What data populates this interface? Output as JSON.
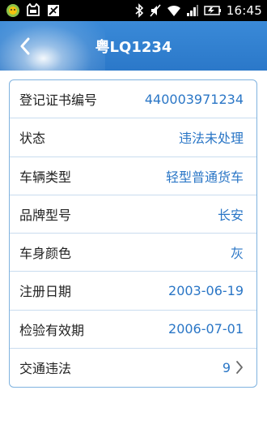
{
  "status_bar": {
    "time": "16:45",
    "left_icons": [
      "wechat-icon",
      "cat-icon",
      "nosim-icon"
    ],
    "right_icons": [
      "bluetooth-icon",
      "mute-icon",
      "wifi-icon",
      "signal-icon",
      "battery-icon"
    ]
  },
  "header": {
    "title": "粤LQ1234",
    "back_icon": "chevron-left-icon"
  },
  "details": [
    {
      "label": "登记证书编号",
      "value": "440003971234"
    },
    {
      "label": "状态",
      "value": "违法未处理"
    },
    {
      "label": "车辆类型",
      "value": "轻型普通货车"
    },
    {
      "label": "品牌型号",
      "value": "长安"
    },
    {
      "label": "车身颜色",
      "value": "灰"
    },
    {
      "label": "注册日期",
      "value": "2003-06-19"
    },
    {
      "label": "检验有效期",
      "value": "2006-07-01"
    },
    {
      "label": "交通违法",
      "value": "9"
    }
  ],
  "colors": {
    "header": "#2b78c9",
    "value_text": "#2a76c6",
    "border": "#7fb2df"
  }
}
